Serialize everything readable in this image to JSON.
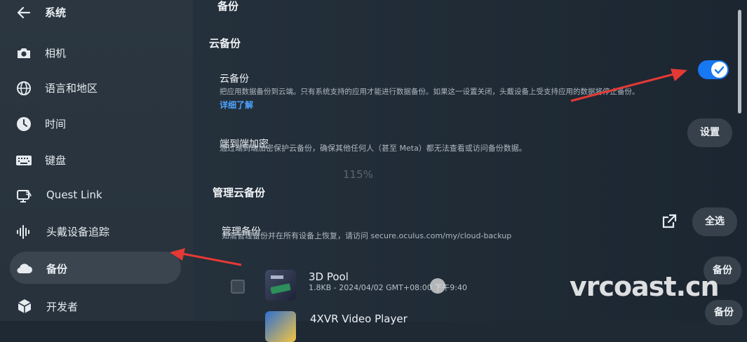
{
  "sidebar": {
    "back_label": "系统",
    "items": [
      {
        "label": "相机",
        "icon": "camera-icon"
      },
      {
        "label": "语言和地区",
        "icon": "globe-icon"
      },
      {
        "label": "时间",
        "icon": "clock-icon"
      },
      {
        "label": "键盘",
        "icon": "keyboard-icon"
      },
      {
        "label": "Quest Link",
        "icon": "quest-link-icon"
      },
      {
        "label": "头戴设备追踪",
        "icon": "tracking-icon"
      },
      {
        "label": "备份",
        "icon": "cloud-icon",
        "active": true
      },
      {
        "label": "开发者",
        "icon": "cube-icon"
      }
    ]
  },
  "main": {
    "page_title": "备份",
    "cloud_section": {
      "title": "云备份",
      "cloud_backup": {
        "title": "云备份",
        "description": "把应用数据备份到云端。只有系统支持的应用才能进行数据备份。如果这一设置关闭，头戴设备上受支持应用的数据将停止备份。",
        "link": "详细了解",
        "toggle_on": true
      },
      "encryption": {
        "title": "端到端加密",
        "description": "通过端到端加密保护云备份，确保其他任何人（甚至 Meta）都无法查看或访问备份数据。",
        "button": "设置"
      }
    },
    "zoom": "115%",
    "manage_section": {
      "title": "管理云备份",
      "manage": {
        "title": "管理备份",
        "description": "如需管理备份并在所有设备上恢复，请访问 secure.oculus.com/my/cloud-backup",
        "select_all": "全选",
        "external_icon": "external-link-icon"
      },
      "apps": [
        {
          "name": "3D Pool",
          "meta": "1.8KB - 2024/04/02 GMT+08:00 下午9:40",
          "button": "备份"
        },
        {
          "name": "4XVR Video Player",
          "meta": "",
          "button": "备份"
        }
      ]
    }
  },
  "watermark": "vrcoast.cn",
  "colors": {
    "accent": "#1877f2",
    "link": "#4da3ff",
    "arrow": "#e53935"
  }
}
